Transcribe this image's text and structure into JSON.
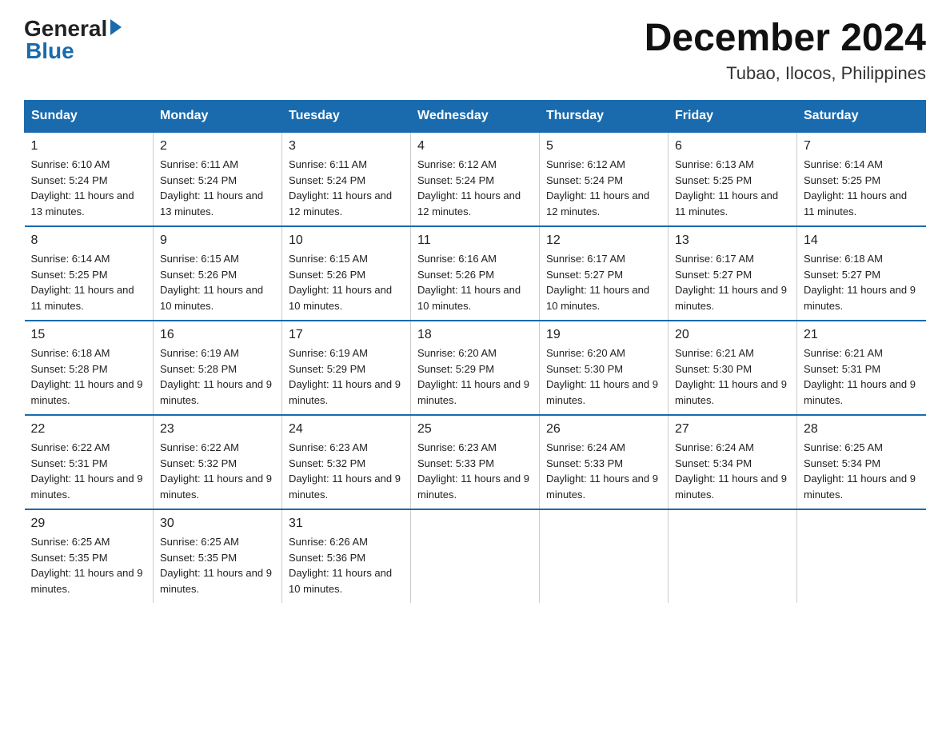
{
  "logo": {
    "general": "General",
    "blue": "Blue"
  },
  "title": {
    "month": "December 2024",
    "location": "Tubao, Ilocos, Philippines"
  },
  "headers": [
    "Sunday",
    "Monday",
    "Tuesday",
    "Wednesday",
    "Thursday",
    "Friday",
    "Saturday"
  ],
  "weeks": [
    [
      {
        "day": "1",
        "sunrise": "6:10 AM",
        "sunset": "5:24 PM",
        "daylight": "11 hours and 13 minutes."
      },
      {
        "day": "2",
        "sunrise": "6:11 AM",
        "sunset": "5:24 PM",
        "daylight": "11 hours and 13 minutes."
      },
      {
        "day": "3",
        "sunrise": "6:11 AM",
        "sunset": "5:24 PM",
        "daylight": "11 hours and 12 minutes."
      },
      {
        "day": "4",
        "sunrise": "6:12 AM",
        "sunset": "5:24 PM",
        "daylight": "11 hours and 12 minutes."
      },
      {
        "day": "5",
        "sunrise": "6:12 AM",
        "sunset": "5:24 PM",
        "daylight": "11 hours and 12 minutes."
      },
      {
        "day": "6",
        "sunrise": "6:13 AM",
        "sunset": "5:25 PM",
        "daylight": "11 hours and 11 minutes."
      },
      {
        "day": "7",
        "sunrise": "6:14 AM",
        "sunset": "5:25 PM",
        "daylight": "11 hours and 11 minutes."
      }
    ],
    [
      {
        "day": "8",
        "sunrise": "6:14 AM",
        "sunset": "5:25 PM",
        "daylight": "11 hours and 11 minutes."
      },
      {
        "day": "9",
        "sunrise": "6:15 AM",
        "sunset": "5:26 PM",
        "daylight": "11 hours and 10 minutes."
      },
      {
        "day": "10",
        "sunrise": "6:15 AM",
        "sunset": "5:26 PM",
        "daylight": "11 hours and 10 minutes."
      },
      {
        "day": "11",
        "sunrise": "6:16 AM",
        "sunset": "5:26 PM",
        "daylight": "11 hours and 10 minutes."
      },
      {
        "day": "12",
        "sunrise": "6:17 AM",
        "sunset": "5:27 PM",
        "daylight": "11 hours and 10 minutes."
      },
      {
        "day": "13",
        "sunrise": "6:17 AM",
        "sunset": "5:27 PM",
        "daylight": "11 hours and 9 minutes."
      },
      {
        "day": "14",
        "sunrise": "6:18 AM",
        "sunset": "5:27 PM",
        "daylight": "11 hours and 9 minutes."
      }
    ],
    [
      {
        "day": "15",
        "sunrise": "6:18 AM",
        "sunset": "5:28 PM",
        "daylight": "11 hours and 9 minutes."
      },
      {
        "day": "16",
        "sunrise": "6:19 AM",
        "sunset": "5:28 PM",
        "daylight": "11 hours and 9 minutes."
      },
      {
        "day": "17",
        "sunrise": "6:19 AM",
        "sunset": "5:29 PM",
        "daylight": "11 hours and 9 minutes."
      },
      {
        "day": "18",
        "sunrise": "6:20 AM",
        "sunset": "5:29 PM",
        "daylight": "11 hours and 9 minutes."
      },
      {
        "day": "19",
        "sunrise": "6:20 AM",
        "sunset": "5:30 PM",
        "daylight": "11 hours and 9 minutes."
      },
      {
        "day": "20",
        "sunrise": "6:21 AM",
        "sunset": "5:30 PM",
        "daylight": "11 hours and 9 minutes."
      },
      {
        "day": "21",
        "sunrise": "6:21 AM",
        "sunset": "5:31 PM",
        "daylight": "11 hours and 9 minutes."
      }
    ],
    [
      {
        "day": "22",
        "sunrise": "6:22 AM",
        "sunset": "5:31 PM",
        "daylight": "11 hours and 9 minutes."
      },
      {
        "day": "23",
        "sunrise": "6:22 AM",
        "sunset": "5:32 PM",
        "daylight": "11 hours and 9 minutes."
      },
      {
        "day": "24",
        "sunrise": "6:23 AM",
        "sunset": "5:32 PM",
        "daylight": "11 hours and 9 minutes."
      },
      {
        "day": "25",
        "sunrise": "6:23 AM",
        "sunset": "5:33 PM",
        "daylight": "11 hours and 9 minutes."
      },
      {
        "day": "26",
        "sunrise": "6:24 AM",
        "sunset": "5:33 PM",
        "daylight": "11 hours and 9 minutes."
      },
      {
        "day": "27",
        "sunrise": "6:24 AM",
        "sunset": "5:34 PM",
        "daylight": "11 hours and 9 minutes."
      },
      {
        "day": "28",
        "sunrise": "6:25 AM",
        "sunset": "5:34 PM",
        "daylight": "11 hours and 9 minutes."
      }
    ],
    [
      {
        "day": "29",
        "sunrise": "6:25 AM",
        "sunset": "5:35 PM",
        "daylight": "11 hours and 9 minutes."
      },
      {
        "day": "30",
        "sunrise": "6:25 AM",
        "sunset": "5:35 PM",
        "daylight": "11 hours and 9 minutes."
      },
      {
        "day": "31",
        "sunrise": "6:26 AM",
        "sunset": "5:36 PM",
        "daylight": "11 hours and 10 minutes."
      },
      null,
      null,
      null,
      null
    ]
  ]
}
